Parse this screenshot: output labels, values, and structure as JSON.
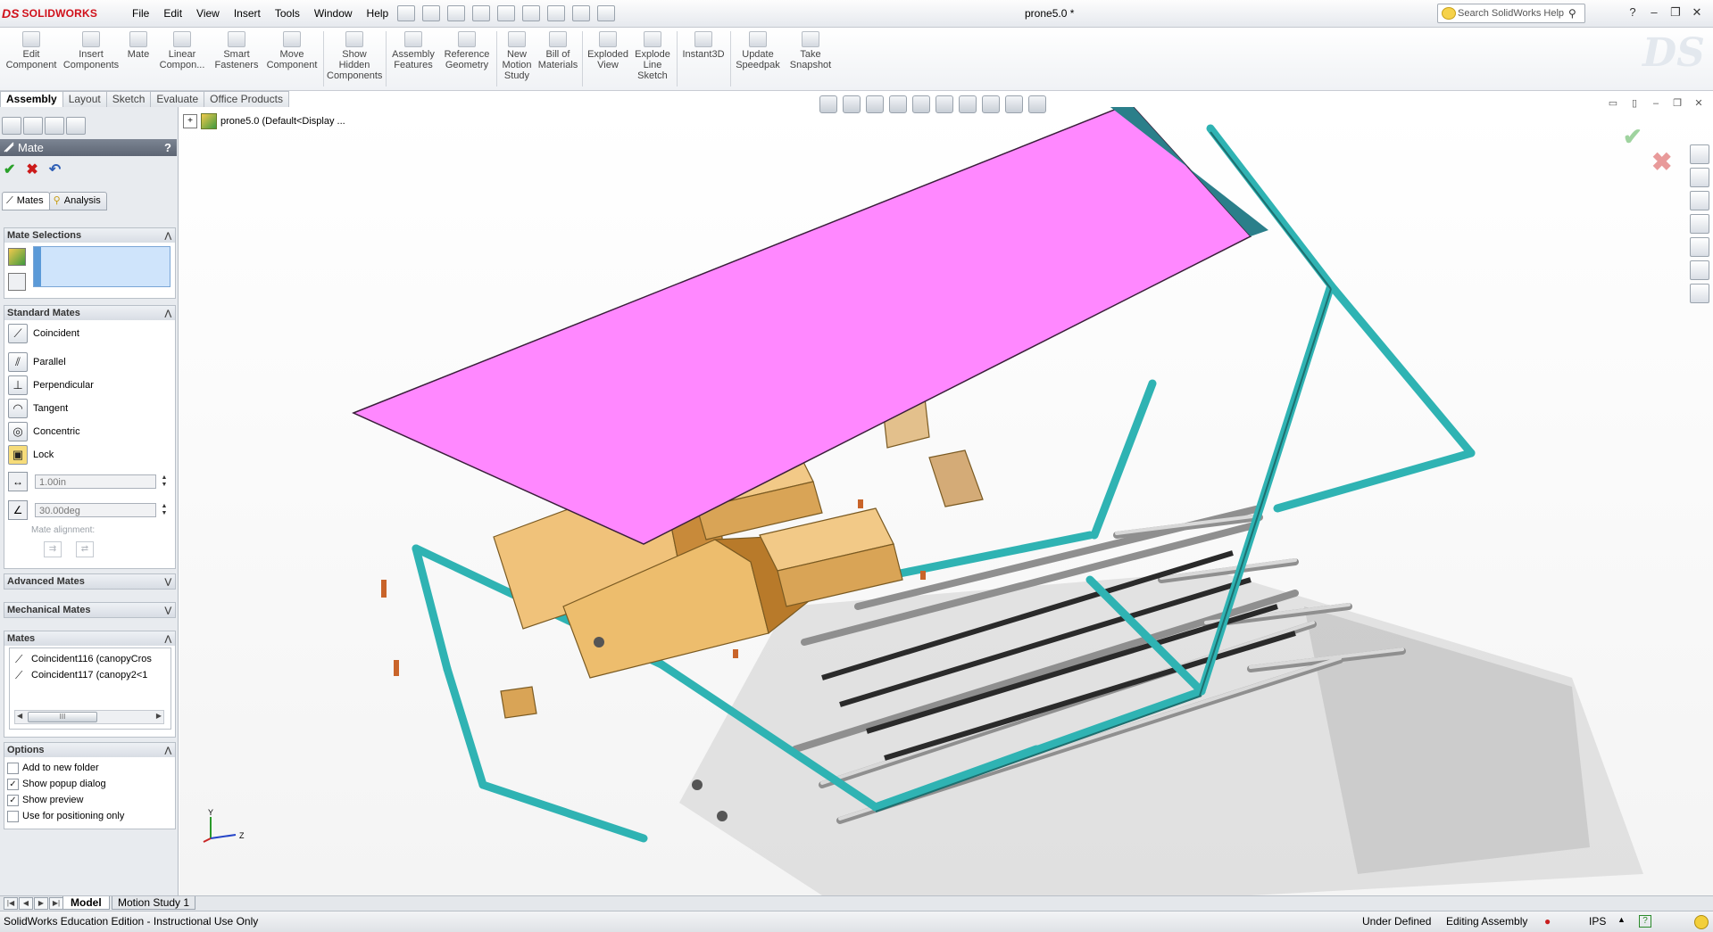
{
  "app": {
    "brand": "SOLIDWORKS",
    "document_title": "prone5.0 *"
  },
  "menu": [
    "File",
    "Edit",
    "View",
    "Insert",
    "Tools",
    "Window",
    "Help"
  ],
  "search": {
    "placeholder": "Search SolidWorks Help"
  },
  "command_manager": {
    "buttons": [
      {
        "label": "Edit Component"
      },
      {
        "label": "Insert Components"
      },
      {
        "label": "Mate"
      },
      {
        "label": "Linear Compon..."
      },
      {
        "label": "Smart Fasteners"
      },
      {
        "label": "Move Component"
      },
      {
        "label": "Show Hidden Components"
      },
      {
        "label": "Assembly Features"
      },
      {
        "label": "Reference Geometry"
      },
      {
        "label": "New Motion Study"
      },
      {
        "label": "Bill of Materials"
      },
      {
        "label": "Exploded View"
      },
      {
        "label": "Explode Line Sketch"
      },
      {
        "label": "Instant3D"
      },
      {
        "label": "Update Speedpak"
      },
      {
        "label": "Take Snapshot"
      }
    ],
    "tabs": [
      "Assembly",
      "Layout",
      "Sketch",
      "Evaluate",
      "Office Products"
    ],
    "active_tab": "Assembly"
  },
  "property_manager": {
    "title": "Mate",
    "help": "?",
    "subtabs": [
      "Mates",
      "Analysis"
    ],
    "mate_selections": {
      "header": "Mate Selections"
    },
    "standard_mates": {
      "header": "Standard Mates",
      "items": [
        "Coincident",
        "Parallel",
        "Perpendicular",
        "Tangent",
        "Concentric",
        "Lock"
      ],
      "distance_value": "1.00in",
      "angle_value": "30.00deg",
      "alignment_label": "Mate alignment:"
    },
    "advanced_mates": {
      "header": "Advanced Mates"
    },
    "mechanical_mates": {
      "header": "Mechanical Mates"
    },
    "mates": {
      "header": "Mates",
      "items": [
        "Coincident116 (canopyCros",
        "Coincident117 (canopy2<1"
      ],
      "scroll_grip": "III"
    },
    "options": {
      "header": "Options",
      "items": [
        {
          "label": "Add to new folder",
          "checked": false
        },
        {
          "label": "Show popup dialog",
          "checked": true
        },
        {
          "label": "Show preview",
          "checked": true
        },
        {
          "label": "Use for positioning only",
          "checked": false
        }
      ]
    }
  },
  "feature_tree": {
    "root": "prone5.0  (Default<Display ..."
  },
  "triad": {
    "y": "Y",
    "z": "Z"
  },
  "bottom_tabs": {
    "model": "Model",
    "motion": "Motion Study 1"
  },
  "status": {
    "left": "SolidWorks Education Edition - Instructional Use Only",
    "state": "Under Defined",
    "mode": "Editing Assembly",
    "units": "IPS",
    "help": "?"
  },
  "colors": {
    "frame_teal": "#2fb3b3",
    "canopy_pink": "#ff88ff",
    "block_tan": "#e6b466",
    "accent_red": "#d0101a"
  }
}
